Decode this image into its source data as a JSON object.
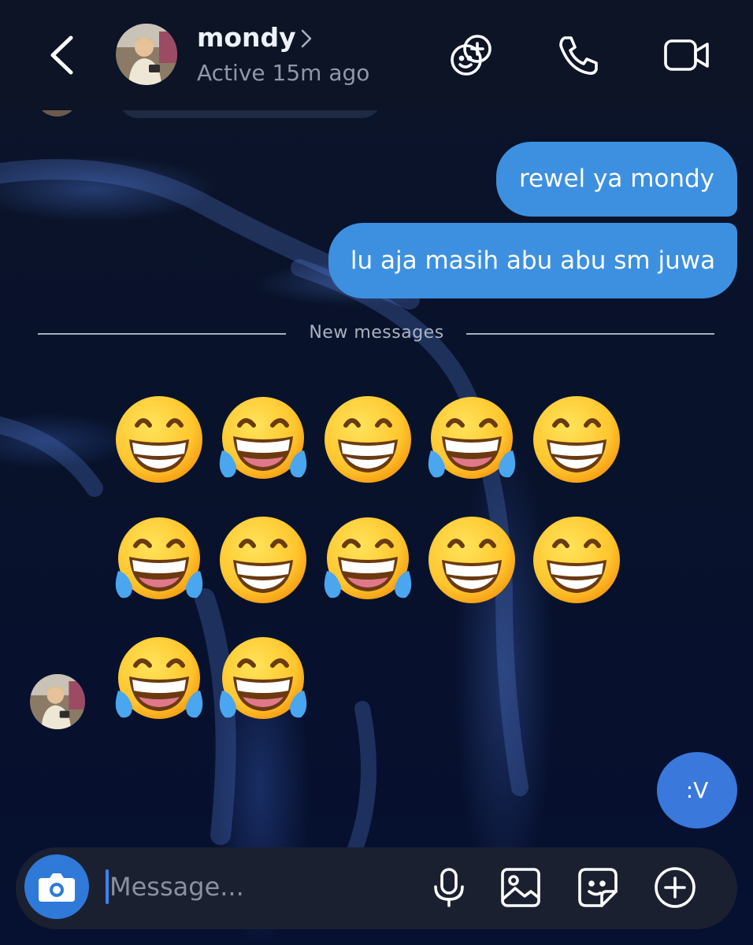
{
  "header": {
    "contact_name": "mondy",
    "status": "Active 15m ago"
  },
  "messages": [
    {
      "from": "me",
      "text": "rewel ya mondy"
    },
    {
      "from": "me",
      "text": "lu aja masih abu abu sm juwa"
    },
    {
      "from": "them",
      "type": "emoji",
      "emojis": [
        "grinning",
        "tears-of-joy",
        "grinning",
        "tears-of-joy",
        "grinning",
        "tears-of-joy",
        "grinning",
        "tears-of-joy",
        "grinning",
        "grinning",
        "tears-of-joy",
        "tears-of-joy"
      ]
    },
    {
      "from": "me",
      "text": ":V"
    }
  ],
  "divider": {
    "label": "New messages"
  },
  "composer": {
    "placeholder": "Message..."
  },
  "colors": {
    "bubble": "#3d90e0",
    "accent": "#2f79d9",
    "background": "#0a1226"
  }
}
